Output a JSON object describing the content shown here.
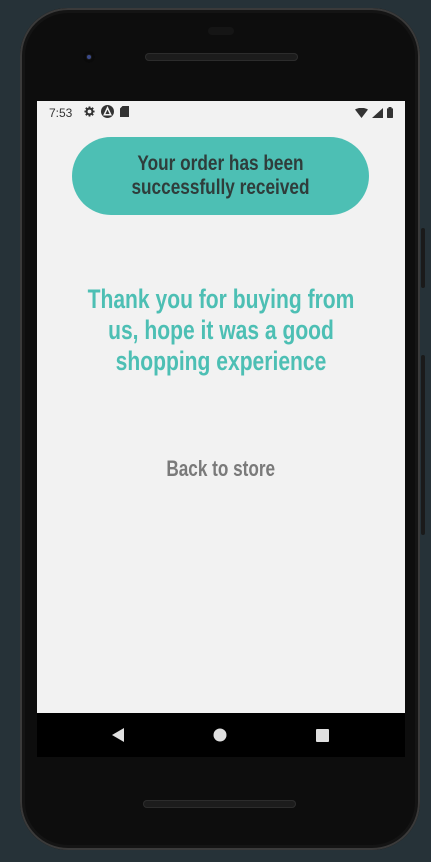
{
  "status_bar": {
    "time": "7:53",
    "left_icons": [
      "settings-icon",
      "a11y-icon",
      "sd-card-icon"
    ],
    "right_icons": [
      "wifi-icon",
      "signal-icon",
      "battery-icon"
    ]
  },
  "banner": {
    "text": "Your order has been successfully received"
  },
  "message": {
    "text": "Thank you for buying from us, hope it was a good shopping experience"
  },
  "actions": {
    "back_label": "Back to store"
  },
  "nav": {
    "buttons": [
      "back-nav-icon",
      "home-nav-icon",
      "recents-nav-icon"
    ]
  },
  "colors": {
    "accent": "#4dbfb4",
    "banner_text": "#2f3d3b",
    "link_text": "#7a7a7a",
    "screen_bg": "#f2f2f2",
    "backdrop": "#263238"
  }
}
